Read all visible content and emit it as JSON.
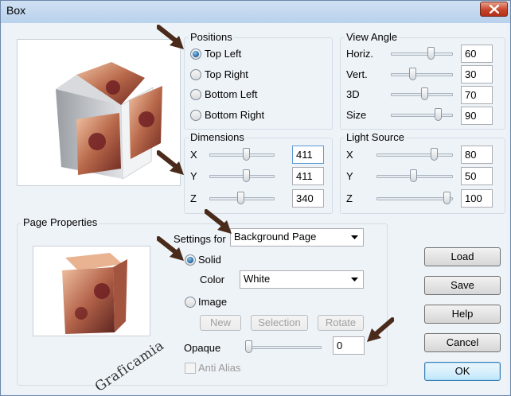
{
  "window": {
    "title": "Box"
  },
  "positions": {
    "title": "Positions",
    "options": [
      "Top Left",
      "Top Right",
      "Bottom Left",
      "Bottom Right"
    ],
    "selected": "Top Left"
  },
  "view_angle": {
    "title": "View Angle",
    "rows": [
      {
        "label": "Horiz.",
        "value": "60"
      },
      {
        "label": "Vert.",
        "value": "30"
      },
      {
        "label": "3D",
        "value": "70"
      },
      {
        "label": "Size",
        "value": "90"
      }
    ]
  },
  "dimensions": {
    "title": "Dimensions",
    "rows": [
      {
        "label": "X",
        "value": "411"
      },
      {
        "label": "Y",
        "value": "411"
      },
      {
        "label": "Z",
        "value": "340"
      }
    ]
  },
  "light_source": {
    "title": "Light Source",
    "rows": [
      {
        "label": "X",
        "value": "80"
      },
      {
        "label": "Y",
        "value": "50"
      },
      {
        "label": "Z",
        "value": "100"
      }
    ]
  },
  "page_properties": {
    "title": "Page Properties",
    "settings_for_label": "Settings for",
    "settings_for_value": "Background Page",
    "solid_label": "Solid",
    "color_label": "Color",
    "color_value": "White",
    "image_label": "Image",
    "new_label": "New",
    "selection_label": "Selection",
    "rotate_label": "Rotate",
    "opaque_label": "Opaque",
    "opaque_value": "0",
    "anti_alias_label": "Anti Alias"
  },
  "buttons": {
    "load": "Load",
    "save": "Save",
    "help": "Help",
    "cancel": "Cancel",
    "ok": "OK"
  },
  "watermark": "Graficamia",
  "colors": {
    "accent": "#3c7fb1",
    "annotation_arrow": "#4a2a1a"
  }
}
